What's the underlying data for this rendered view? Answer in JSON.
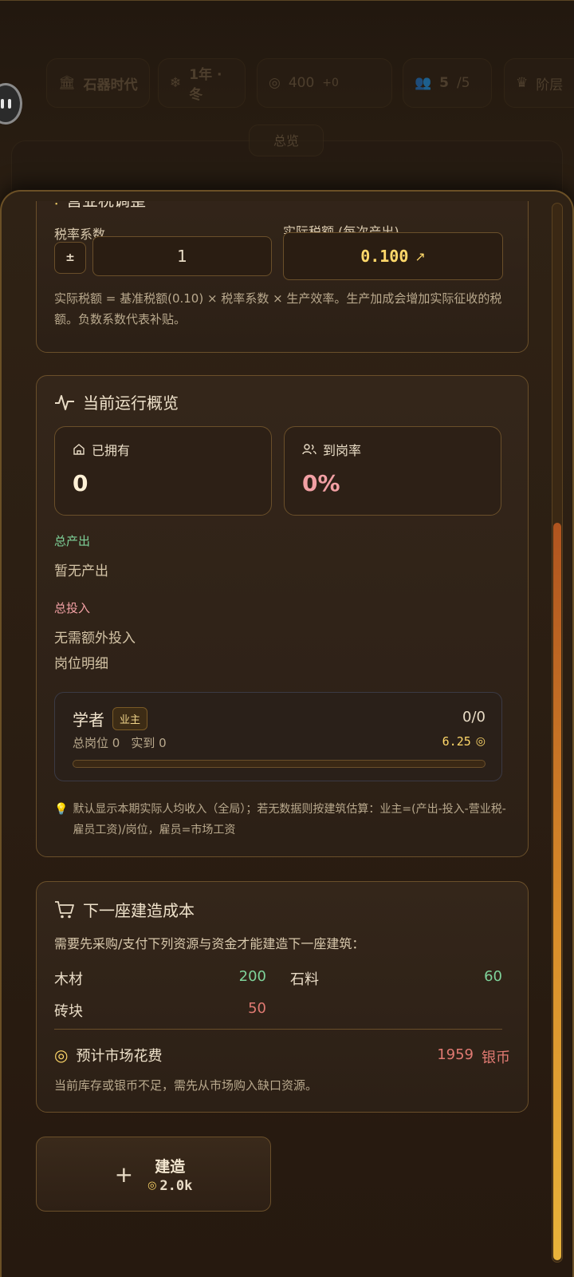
{
  "background": {
    "era_label": "石器时代",
    "season_label": "1年 · 冬",
    "silver_amount": "400",
    "silver_delta": "+0",
    "population": "5",
    "population_cap": "/5",
    "rank_label": "阶层",
    "tab_overview": "总览"
  },
  "tax": {
    "title": "营业税调整",
    "coef_label": "税率系数",
    "toggle_label": "±",
    "coef_value": "1",
    "actual_label": "实际税额 (每次产出)",
    "actual_value": "0.100",
    "note": "实际税额 = 基准税额(0.10) × 税率系数 × 生产效率。生产加成会增加实际征收的税额。负数系数代表补贴。"
  },
  "overview": {
    "title": "当前运行概览",
    "owned_label": "已拥有",
    "owned_value": "0",
    "staffing_label": "到岗率",
    "staffing_value": "0%",
    "output_label": "总产出",
    "output_value": "暂无产出",
    "input_label": "总投入",
    "input_value": "无需额外投入",
    "jobs_label": "岗位明细",
    "job": {
      "name": "学者",
      "badge": "业主",
      "count": "0/0",
      "slots_text": "总岗位 0",
      "present_text": "实到 0",
      "income": "6.25",
      "fill_fraction": 0
    },
    "tip": "默认显示本期实际人均收入（全局）；若无数据则按建筑估算：业主=(产出-投入-营业税-雇员工资)/岗位，雇员=市场工资"
  },
  "cost": {
    "title": "下一座建造成本",
    "desc": "需要先采购/支付下列资源与资金才能建造下一座建筑：",
    "resources": [
      {
        "name": "木材",
        "amount": "200",
        "status": "ok"
      },
      {
        "name": "石料",
        "amount": "60",
        "status": "ok"
      },
      {
        "name": "砖块",
        "amount": "50",
        "status": "short"
      }
    ],
    "market_label": "预计市场花费",
    "market_value": "1959",
    "market_unit": "银币",
    "warning": "当前库存或银币不足，需先从市场购入缺口资源。"
  },
  "build_button": {
    "label": "建造",
    "cost": "2.0k"
  },
  "colors": {
    "accent_gold": "#ffd86a",
    "green": "#7fd39a",
    "red": "#e07a72",
    "pink": "#f2a0a4",
    "border": "#6a4f2a"
  }
}
